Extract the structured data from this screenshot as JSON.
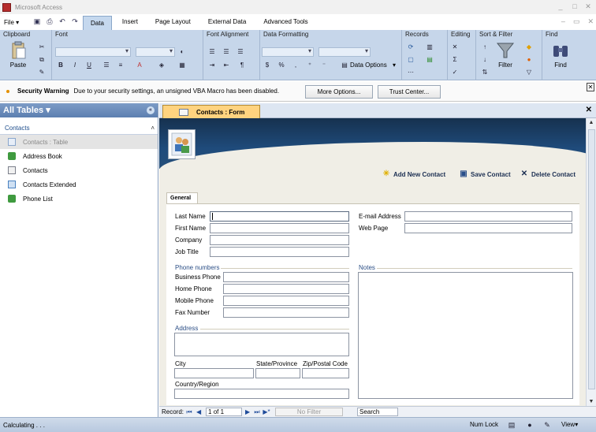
{
  "window": {
    "title": "Microsoft Access",
    "min": "_",
    "max": "□",
    "close": "✕"
  },
  "menu": {
    "file": "File ▾"
  },
  "tabs": [
    "Data",
    "Insert",
    "Page Layout",
    "External Data",
    "Advanced Tools"
  ],
  "ribbon": {
    "groups": [
      "Clipboard",
      "Font",
      "Font Alignment",
      "Data Formatting",
      "Records",
      "Editing",
      "Sort & Filter",
      "Find"
    ],
    "paste": "Paste",
    "data_options": "Data Options",
    "filter": "Filter",
    "find": "Find",
    "bold": "B",
    "italic": "I",
    "underline": "U",
    "currency": "$",
    "percent": "%",
    "comma": ","
  },
  "security": {
    "title": "Security Warning",
    "message": "Due to your security settings, an unsigned VBA Macro has been disabled.",
    "more_options": "More Options...",
    "trust_center": "Trust Center..."
  },
  "nav": {
    "header": "All Tables ▾",
    "group": "Contacts",
    "items": [
      {
        "label": "Contacts : Table",
        "color": "#8aa6cc"
      },
      {
        "label": "Address Book",
        "color": "#3f9a3f"
      },
      {
        "label": "Contacts",
        "color": "#7b7f8a"
      },
      {
        "label": "Contacts Extended",
        "color": "#4a82c0"
      },
      {
        "label": "Phone List",
        "color": "#3f9a3f"
      }
    ]
  },
  "document": {
    "tab": "Contacts : Form",
    "actions": {
      "add": "Add New Contact",
      "save": "Save Contact",
      "delete": "Delete Contact"
    },
    "form_tab": "General",
    "fields_left": [
      "Last Name",
      "First Name",
      "Company",
      "Job Title"
    ],
    "fields_right": [
      "E-mail Address",
      "Web Page"
    ],
    "phone_header": "Phone numbers",
    "phone_fields": [
      "Business Phone",
      "Home Phone",
      "Mobile Phone",
      "Fax Number"
    ],
    "notes_header": "Notes",
    "address_header": "Address",
    "city": "City",
    "state": "State/Province",
    "zip": "Zip/Postal Code",
    "country": "Country/Region"
  },
  "recordnav": {
    "label": "Record:",
    "position": "1 of 1",
    "filter": "No Filter",
    "search": "Search"
  },
  "status": {
    "left": "Calculating . . .",
    "numlock": "Num Lock",
    "view": "View▾"
  }
}
